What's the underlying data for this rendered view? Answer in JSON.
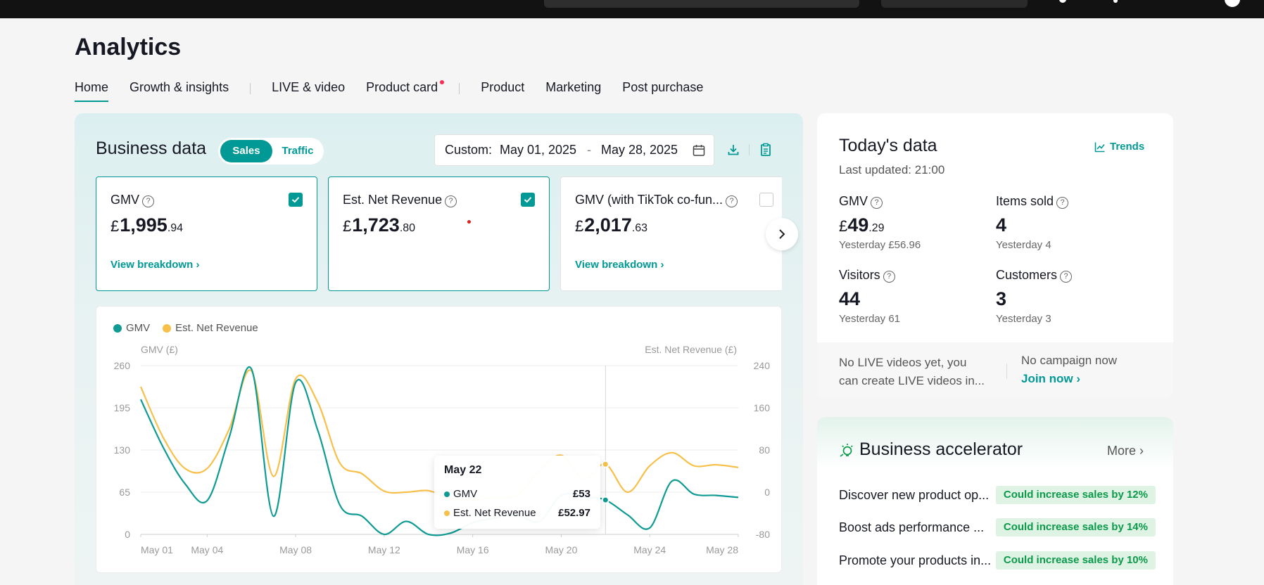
{
  "page_title": "Analytics",
  "tabs": [
    {
      "label": "Home",
      "active": true
    },
    {
      "label": "Growth & insights"
    },
    {
      "label": "LIVE & video"
    },
    {
      "label": "Product card",
      "dot": true
    },
    {
      "label": "Product"
    },
    {
      "label": "Marketing"
    },
    {
      "label": "Post purchase"
    }
  ],
  "business": {
    "title": "Business data",
    "toggle": {
      "sales": "Sales",
      "traffic": "Traffic"
    },
    "date": {
      "prefix": "Custom:",
      "start": "May 01, 2025",
      "dash": "-",
      "end": "May 28, 2025"
    },
    "cards": [
      {
        "label": "GMV",
        "currency": "£",
        "whole": "1,995",
        "decimal": ".94",
        "link": "View breakdown",
        "checked": true
      },
      {
        "label": "Est. Net Revenue",
        "currency": "£",
        "whole": "1,723",
        "decimal": ".80",
        "link": "",
        "checked": true
      },
      {
        "label": "GMV (with TikTok co-fun...",
        "currency": "£",
        "whole": "2,017",
        "decimal": ".63",
        "link": "View breakdown",
        "checked": false
      }
    ]
  },
  "chart_data": {
    "type": "line",
    "legend": [
      "GMV",
      "Est. Net Revenue"
    ],
    "left_axis_label": "GMV (£)",
    "right_axis_label": "Est. Net Revenue (£)",
    "left_ticks": [
      "260",
      "195",
      "130",
      "65",
      "0"
    ],
    "right_ticks": [
      "240",
      "160",
      "80",
      "0",
      "-80"
    ],
    "left_range": [
      0,
      260
    ],
    "right_range": [
      -80,
      240
    ],
    "x_ticks": [
      {
        "day": 1,
        "label": "May 01"
      },
      {
        "day": 4,
        "label": "May 04"
      },
      {
        "day": 8,
        "label": "May 08"
      },
      {
        "day": 12,
        "label": "May 12"
      },
      {
        "day": 16,
        "label": "May 16"
      },
      {
        "day": 20,
        "label": "May 20"
      },
      {
        "day": 24,
        "label": "May 24"
      },
      {
        "day": 28,
        "label": "May 28"
      }
    ],
    "series": [
      {
        "name": "GMV",
        "color": "#0f9b94",
        "axis": "left",
        "points": [
          [
            1,
            208
          ],
          [
            2,
            135
          ],
          [
            3,
            78
          ],
          [
            4,
            52
          ],
          [
            5,
            150
          ],
          [
            6,
            255
          ],
          [
            7,
            28
          ],
          [
            8,
            234
          ],
          [
            9,
            160
          ],
          [
            10,
            45
          ],
          [
            11,
            28
          ],
          [
            12,
            0
          ],
          [
            13,
            20
          ],
          [
            14,
            0
          ],
          [
            15,
            2
          ],
          [
            16,
            18
          ],
          [
            17,
            25
          ],
          [
            18,
            30
          ],
          [
            19,
            20
          ],
          [
            20,
            60
          ],
          [
            21,
            58
          ],
          [
            22,
            53
          ],
          [
            23,
            30
          ],
          [
            24,
            10
          ],
          [
            25,
            82
          ],
          [
            26,
            62
          ],
          [
            27,
            60
          ],
          [
            28,
            57
          ]
        ]
      },
      {
        "name": "Est. Net Revenue",
        "color": "#f7c04b",
        "axis": "right",
        "points": [
          [
            1,
            200
          ],
          [
            2,
            105
          ],
          [
            3,
            45
          ],
          [
            4,
            45
          ],
          [
            5,
            120
          ],
          [
            6,
            230
          ],
          [
            7,
            30
          ],
          [
            8,
            215
          ],
          [
            9,
            170
          ],
          [
            10,
            55
          ],
          [
            11,
            35
          ],
          [
            12,
            2
          ],
          [
            13,
            0
          ],
          [
            14,
            3
          ],
          [
            15,
            -12
          ],
          [
            16,
            -15
          ],
          [
            17,
            -10
          ],
          [
            18,
            -5
          ],
          [
            19,
            40
          ],
          [
            20,
            70
          ],
          [
            21,
            25
          ],
          [
            22,
            52.97
          ],
          [
            23,
            0
          ],
          [
            24,
            50
          ],
          [
            25,
            75
          ],
          [
            26,
            50
          ],
          [
            27,
            52
          ],
          [
            28,
            47
          ]
        ]
      }
    ],
    "highlight_day": 22
  },
  "tooltip": {
    "date": "May 22",
    "rows": [
      {
        "name": "GMV",
        "value": "£53",
        "color": "#0f9b94"
      },
      {
        "name": "Est. Net Revenue",
        "value": "£52.97",
        "color": "#f7c04b"
      }
    ]
  },
  "today": {
    "title": "Today's data",
    "updated": "Last updated: 21:00",
    "trends": "Trends",
    "gmv": {
      "label": "GMV",
      "currency": "£",
      "whole": "49",
      "decimal": ".29",
      "sub": "Yesterday £56.96"
    },
    "items_sold": {
      "label": "Items sold",
      "value": "4",
      "sub": "Yesterday 4"
    },
    "visitors": {
      "label": "Visitors",
      "value": "44",
      "sub": "Yesterday 61"
    },
    "customers": {
      "label": "Customers",
      "value": "3",
      "sub": "Yesterday 3"
    },
    "live_note_1": "No LIVE videos yet, you",
    "live_note_2": "can create LIVE videos in...",
    "campaign_note": "No campaign now",
    "join_now": "Join now"
  },
  "accelerator": {
    "title": "Business accelerator",
    "more": "More",
    "items": [
      {
        "text": "Discover new product op...",
        "badge": "Could increase sales by 12%"
      },
      {
        "text": "Boost ads performance ...",
        "badge": "Could increase sales by 14%"
      },
      {
        "text": "Promote your products in...",
        "badge": "Could increase sales by 10%"
      }
    ]
  },
  "colors": {
    "accent": "#009995",
    "gmv": "#0f9b94",
    "net": "#f7c04b",
    "badge_green": "#0b9a4a"
  }
}
